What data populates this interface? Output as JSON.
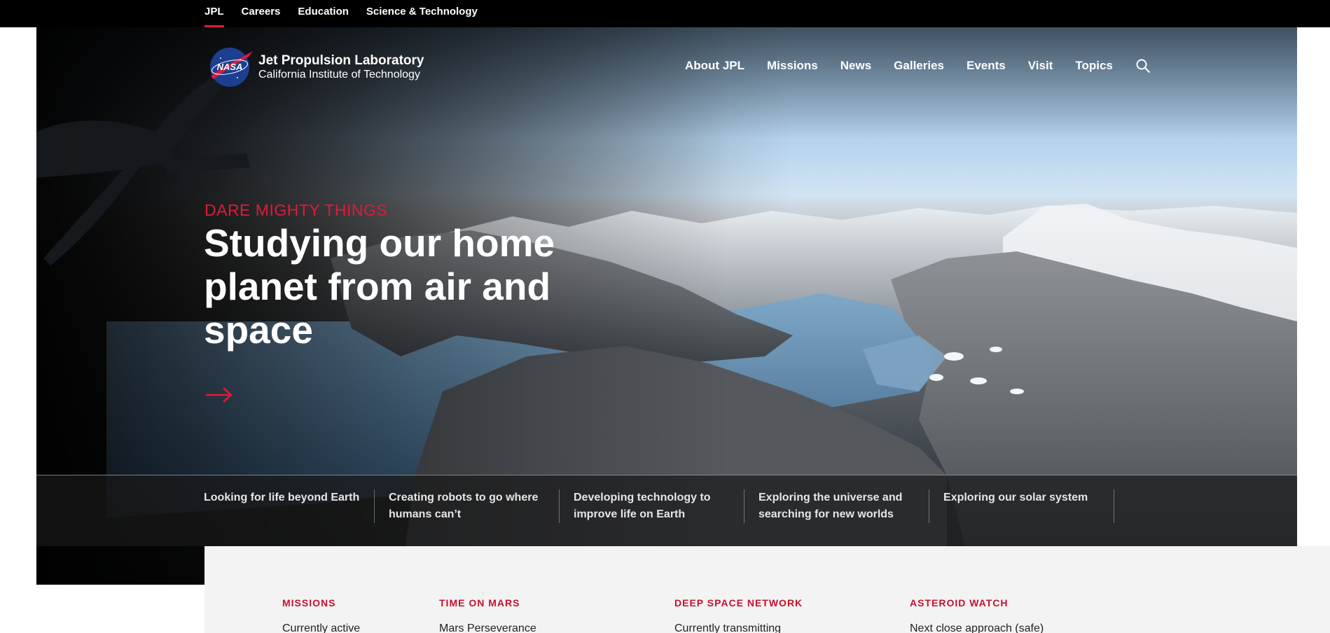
{
  "topbar": {
    "links": [
      {
        "label": "JPL",
        "active": true
      },
      {
        "label": "Careers",
        "active": false
      },
      {
        "label": "Education",
        "active": false
      },
      {
        "label": "Science & Technology",
        "active": false
      }
    ]
  },
  "brand": {
    "title": "Jet Propulsion Laboratory",
    "subtitle": "California Institute of Technology",
    "logo_text": "NASA"
  },
  "nav": {
    "items": [
      "About JPL",
      "Missions",
      "News",
      "Galleries",
      "Events",
      "Visit",
      "Topics"
    ],
    "search_icon": "search-icon"
  },
  "hero": {
    "eyebrow": "DARE MIGHTY THINGS",
    "headline": "Studying our home planet from air and space",
    "arrow_icon": "arrow-right-icon"
  },
  "topics": [
    "Looking for life beyond Earth",
    "Creating robots to go where humans can’t",
    "Developing technology to improve life on Earth",
    "Exploring the universe and searching for new worlds",
    "Exploring our solar system"
  ],
  "stats": [
    {
      "label": "MISSIONS",
      "value": "Currently active"
    },
    {
      "label": "TIME ON MARS",
      "value": "Mars Perseverance"
    },
    {
      "label": "DEEP SPACE NETWORK",
      "value": "Currently transmitting"
    },
    {
      "label": "ASTEROID WATCH",
      "value": "Next close approach (safe)"
    }
  ],
  "colors": {
    "accent": "#e31937",
    "topbar_bg": "#000000",
    "stats_bg": "#f3f3f3",
    "stat_label": "#c8102e"
  }
}
